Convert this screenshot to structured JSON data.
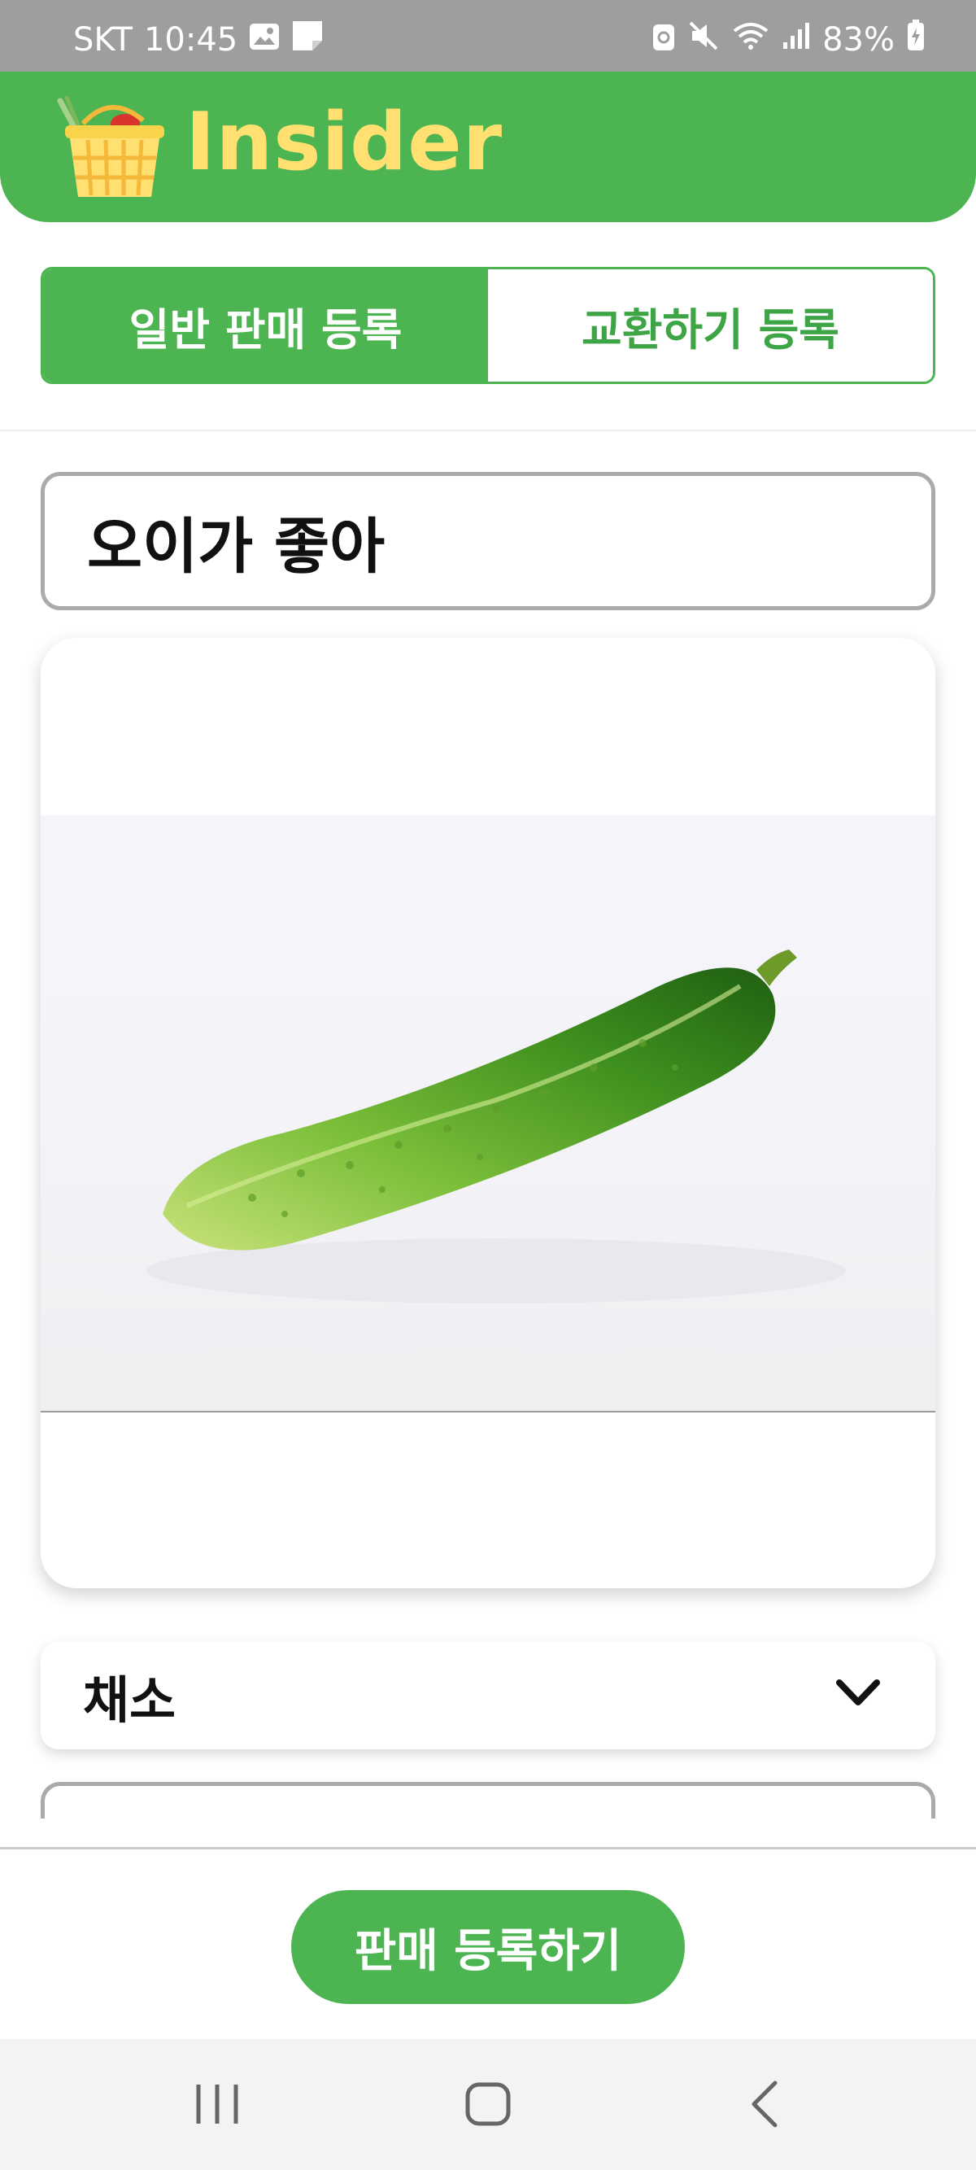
{
  "status_bar": {
    "carrier": "SKT",
    "time": "10:45",
    "battery": "83%"
  },
  "app": {
    "title": "Insider"
  },
  "tabs": [
    {
      "label": "일반 판매 등록",
      "active": true
    },
    {
      "label": "교환하기 등록",
      "active": false
    }
  ],
  "form": {
    "title_value": "오이가 좋아",
    "category_value": "채소"
  },
  "actions": {
    "register_label": "판매 등록하기"
  },
  "colors": {
    "brand_green": "#4cb551",
    "logo_yellow": "#ffe071"
  }
}
